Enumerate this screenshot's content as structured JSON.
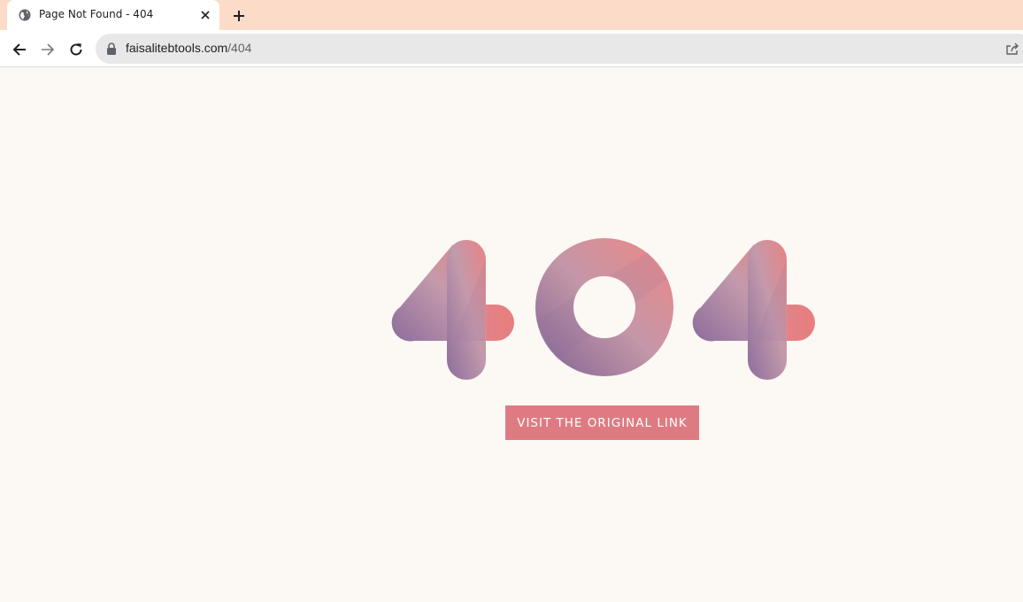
{
  "browser": {
    "tab": {
      "title": "Page Not Found - 404",
      "favicon": "globe-icon"
    },
    "address_bar": {
      "host": "faisalitebtools.com",
      "path": "/404"
    }
  },
  "page": {
    "error_code": "404",
    "button_label": "VISIT THE ORIGINAL LINK",
    "colors": {
      "background": "#fcf8f4",
      "button": "#de7b82",
      "gradient_pink": "#e98383",
      "gradient_purple": "#8c6d9c",
      "tabstrip": "#fcdcc8"
    }
  }
}
